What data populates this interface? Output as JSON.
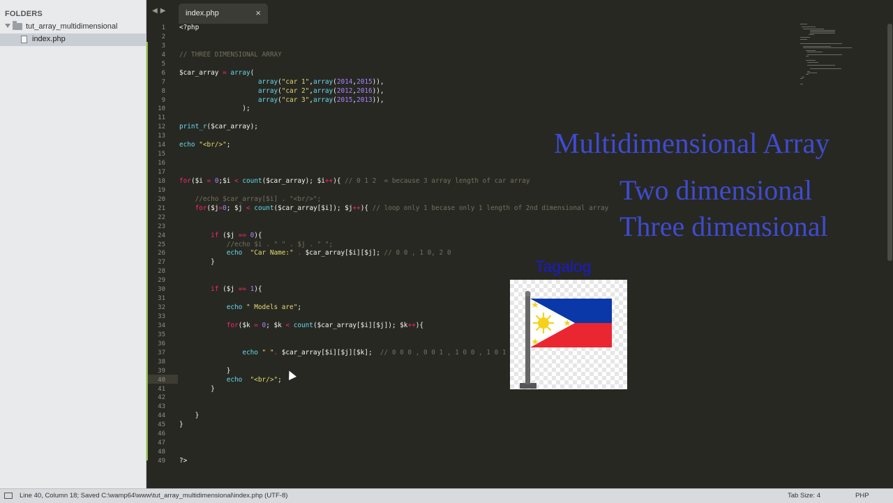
{
  "sidebar": {
    "title": "FOLDERS",
    "folder": "tut_array_multidimensional",
    "file": "index.php"
  },
  "tab": {
    "label": "index.php",
    "close": "×"
  },
  "editor": {
    "lines": [
      [
        [
          "<?php",
          "fg"
        ]
      ],
      [],
      [],
      [
        [
          "// THREE DIMENSIONAL ARRAY",
          "cmt"
        ]
      ],
      [],
      [
        [
          "$car_array ",
          "var"
        ],
        [
          "= ",
          "kw"
        ],
        [
          "array",
          "fn"
        ],
        [
          "(",
          "fg"
        ]
      ],
      [
        [
          "                    array",
          "fn"
        ],
        [
          "(",
          "fg"
        ],
        [
          "\"car 1\"",
          "str"
        ],
        [
          ",",
          "fg"
        ],
        [
          "array",
          "fn"
        ],
        [
          "(",
          "fg"
        ],
        [
          "2014",
          "num"
        ],
        [
          ",",
          "fg"
        ],
        [
          "2015",
          "num"
        ],
        [
          ")),",
          "fg"
        ]
      ],
      [
        [
          "                    array",
          "fn"
        ],
        [
          "(",
          "fg"
        ],
        [
          "\"car 2\"",
          "str"
        ],
        [
          ",",
          "fg"
        ],
        [
          "array",
          "fn"
        ],
        [
          "(",
          "fg"
        ],
        [
          "2012",
          "num"
        ],
        [
          ",",
          "fg"
        ],
        [
          "2016",
          "num"
        ],
        [
          ")),",
          "fg"
        ]
      ],
      [
        [
          "                    array",
          "fn"
        ],
        [
          "(",
          "fg"
        ],
        [
          "\"car 3\"",
          "str"
        ],
        [
          ",",
          "fg"
        ],
        [
          "array",
          "fn"
        ],
        [
          "(",
          "fg"
        ],
        [
          "2015",
          "num"
        ],
        [
          ",",
          "fg"
        ],
        [
          "2013",
          "num"
        ],
        [
          ")),",
          "fg"
        ]
      ],
      [
        [
          "                );",
          "fg"
        ]
      ],
      [],
      [
        [
          "print_r",
          "fn"
        ],
        [
          "($car_array);",
          "fg"
        ]
      ],
      [],
      [
        [
          "echo ",
          "fn"
        ],
        [
          "\"<br/>\"",
          "str"
        ],
        [
          ";",
          "fg"
        ]
      ],
      [],
      [],
      [],
      [
        [
          "for",
          "kw"
        ],
        [
          "($i ",
          "fg"
        ],
        [
          "= ",
          "kw"
        ],
        [
          "0",
          "num"
        ],
        [
          ";$i ",
          "fg"
        ],
        [
          "< ",
          "kw"
        ],
        [
          "count",
          "fn"
        ],
        [
          "($car_array); $i",
          "fg"
        ],
        [
          "++",
          "kw"
        ],
        [
          "){ ",
          "fg"
        ],
        [
          "// 0 1 2  = because 3 array length of car array",
          "cmt"
        ]
      ],
      [],
      [
        [
          "    //echo $car_array[$i] . \"<br/>\";",
          "cmt"
        ]
      ],
      [
        [
          "    ",
          "fg"
        ],
        [
          "for",
          "kw"
        ],
        [
          "($j",
          "fg"
        ],
        [
          "=",
          "kw"
        ],
        [
          "0",
          "num"
        ],
        [
          "; $j ",
          "fg"
        ],
        [
          "< ",
          "kw"
        ],
        [
          "count",
          "fn"
        ],
        [
          "($car_array[$i]); $j",
          "fg"
        ],
        [
          "++",
          "kw"
        ],
        [
          "){ ",
          "fg"
        ],
        [
          "// loop only 1 becase only 1 length of 2nd dimensional array",
          "cmt"
        ]
      ],
      [],
      [],
      [
        [
          "        ",
          "fg"
        ],
        [
          "if",
          "kw"
        ],
        [
          " ($j ",
          "fg"
        ],
        [
          "== ",
          "kw"
        ],
        [
          "0",
          "num"
        ],
        [
          "){",
          "fg"
        ]
      ],
      [
        [
          "            //echo $i . \" \" . $j . \" \";",
          "cmt"
        ]
      ],
      [
        [
          "            ",
          "fg"
        ],
        [
          "echo",
          "fn"
        ],
        [
          "  ",
          "fg"
        ],
        [
          "\"Car Name:\"",
          "str"
        ],
        [
          " . ",
          "kw"
        ],
        [
          "$car_array[$i][$j]; ",
          "fg"
        ],
        [
          "// 0 0 , 1 0, 2 0",
          "cmt"
        ]
      ],
      [
        [
          "        }",
          "fg"
        ]
      ],
      [],
      [],
      [
        [
          "        ",
          "fg"
        ],
        [
          "if",
          "kw"
        ],
        [
          " ($j ",
          "fg"
        ],
        [
          "== ",
          "kw"
        ],
        [
          "1",
          "num"
        ],
        [
          "){",
          "fg"
        ]
      ],
      [],
      [
        [
          "            ",
          "fg"
        ],
        [
          "echo",
          "fn"
        ],
        [
          " ",
          "fg"
        ],
        [
          "\" Models are\"",
          "str"
        ],
        [
          ";",
          "fg"
        ]
      ],
      [],
      [
        [
          "            ",
          "fg"
        ],
        [
          "for",
          "kw"
        ],
        [
          "($k ",
          "fg"
        ],
        [
          "= ",
          "kw"
        ],
        [
          "0",
          "num"
        ],
        [
          "; $k ",
          "fg"
        ],
        [
          "< ",
          "kw"
        ],
        [
          "count",
          "fn"
        ],
        [
          "($car_array[$i][$j]); $k",
          "fg"
        ],
        [
          "++",
          "kw"
        ],
        [
          "){",
          "fg"
        ]
      ],
      [],
      [],
      [
        [
          "                ",
          "fg"
        ],
        [
          "echo",
          "fn"
        ],
        [
          " ",
          "fg"
        ],
        [
          "\" \"",
          "str"
        ],
        [
          ". ",
          "kw"
        ],
        [
          "$car_array[$i][$j][$k];  ",
          "fg"
        ],
        [
          "// 0 0 0 , 0 0 1 , 1 0 0 , 1 0 1",
          "cmt"
        ]
      ],
      [],
      [
        [
          "            }",
          "fg"
        ]
      ],
      [
        [
          "            ",
          "fg"
        ],
        [
          "echo",
          "fn"
        ],
        [
          "  ",
          "fg"
        ],
        [
          "\"<br/>\"",
          "str"
        ],
        [
          ";",
          "fg"
        ]
      ],
      [
        [
          "        }",
          "fg"
        ]
      ],
      [],
      [],
      [
        [
          "    }",
          "fg"
        ]
      ],
      [
        [
          "}",
          "fg"
        ]
      ],
      [],
      [],
      [],
      [
        [
          "?>",
          "fg"
        ]
      ]
    ]
  },
  "overlay": {
    "title": "Multidimensional Array",
    "line1": "Two dimensional",
    "line2": "Three dimensional",
    "tagalog": "Tagalog"
  },
  "flag_colors": {
    "blue": "#0a38a8",
    "red": "#ea2631",
    "white": "#ffffff",
    "yellow": "#f5d11b",
    "pole": "#666666"
  },
  "icons": [
    "folder-icon",
    "file-icon",
    "close-icon",
    "nav-arrows-icon",
    "philippines-flag-icon",
    "status-panel-icon",
    "mouse-cursor-icon"
  ],
  "status": {
    "text": "Line 40, Column 18; Saved C:\\wamp64\\www\\tut_array_multidimensional\\index.php (UTF-8)",
    "tab_size": "Tab Size: 4",
    "syntax": "PHP"
  }
}
